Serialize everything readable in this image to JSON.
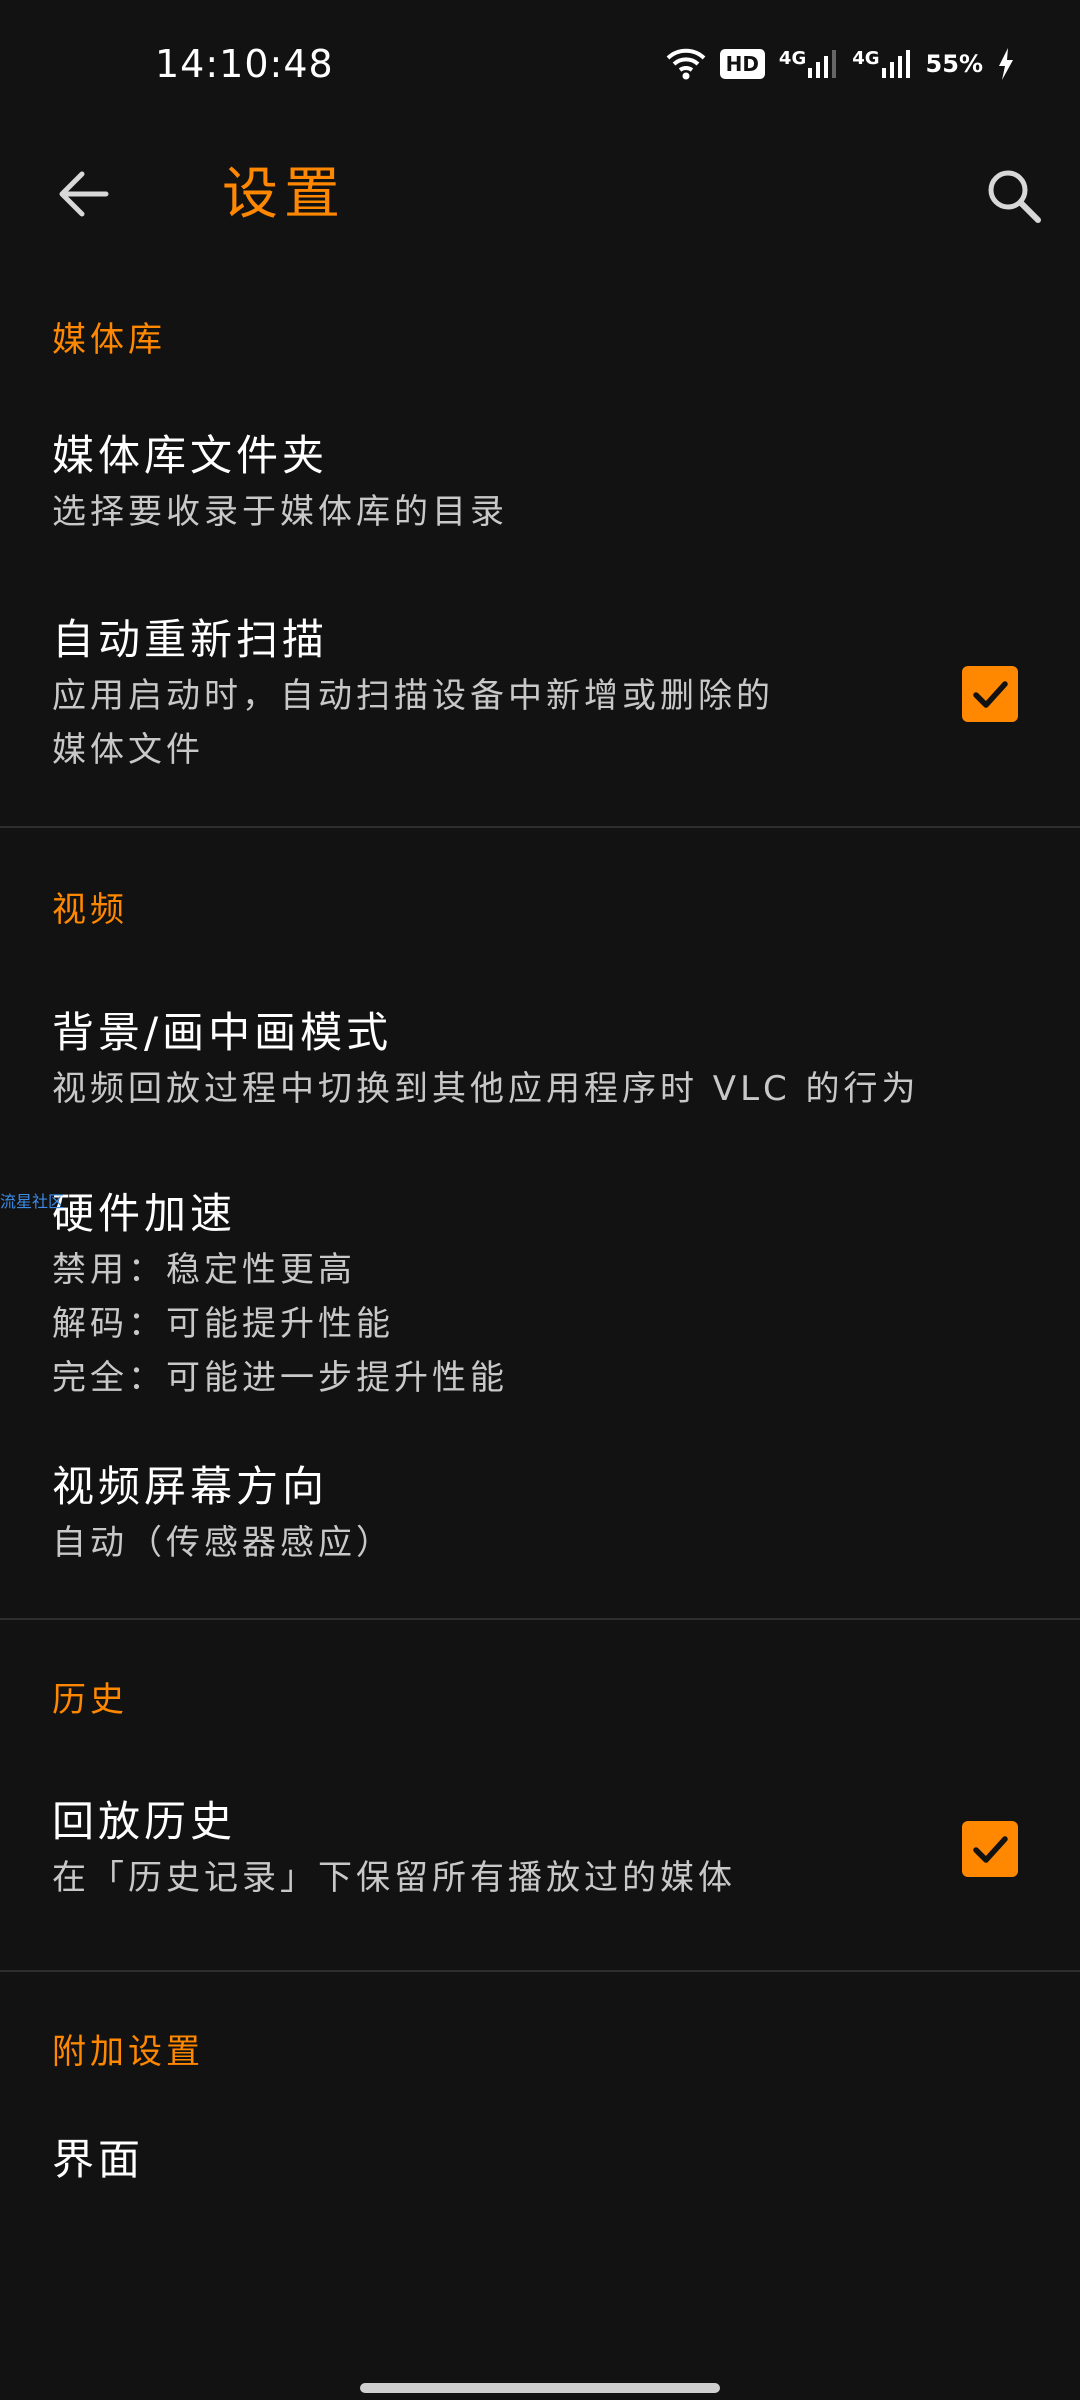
{
  "status_bar": {
    "time": "14:10:48",
    "hd_label": "HD",
    "network_1": "4G",
    "network_2": "4G",
    "battery": "55%",
    "icons": [
      "wifi-icon",
      "hd-icon",
      "signal-icon",
      "signal-icon",
      "charging-icon"
    ]
  },
  "toolbar": {
    "title": "设置",
    "back_icon": "arrow-left-icon",
    "search_icon": "search-icon"
  },
  "sections": {
    "media_library": {
      "header": "媒体库",
      "folders": {
        "title": "媒体库文件夹",
        "summary": "选择要收录于媒体库的目录"
      },
      "auto_rescan": {
        "title": "自动重新扫描",
        "summary": "应用启动时，自动扫描设备中新增或删除的\n媒体文件",
        "checked": true
      }
    },
    "video": {
      "header": "视频",
      "pip": {
        "title": "背景/画中画模式",
        "summary": "视频回放过程中切换到其他应用程序时 VLC 的行为"
      },
      "hw_accel": {
        "title": "硬件加速",
        "summary": "禁用：稳定性更高\n解码：可能提升性能\n完全：可能进一步提升性能"
      },
      "orientation": {
        "title": "视频屏幕方向",
        "summary": "自动（传感器感应）"
      }
    },
    "history": {
      "header": "历史",
      "playback_history": {
        "title": "回放历史",
        "summary": "在「历史记录」下保留所有播放过的媒体",
        "checked": true
      }
    },
    "extra": {
      "header": "附加设置",
      "interface": {
        "title": "界面"
      }
    }
  },
  "watermark": "流星社区",
  "colors": {
    "accent": "#ff8800",
    "background": "#121212",
    "divider": "#2e2e2e"
  }
}
